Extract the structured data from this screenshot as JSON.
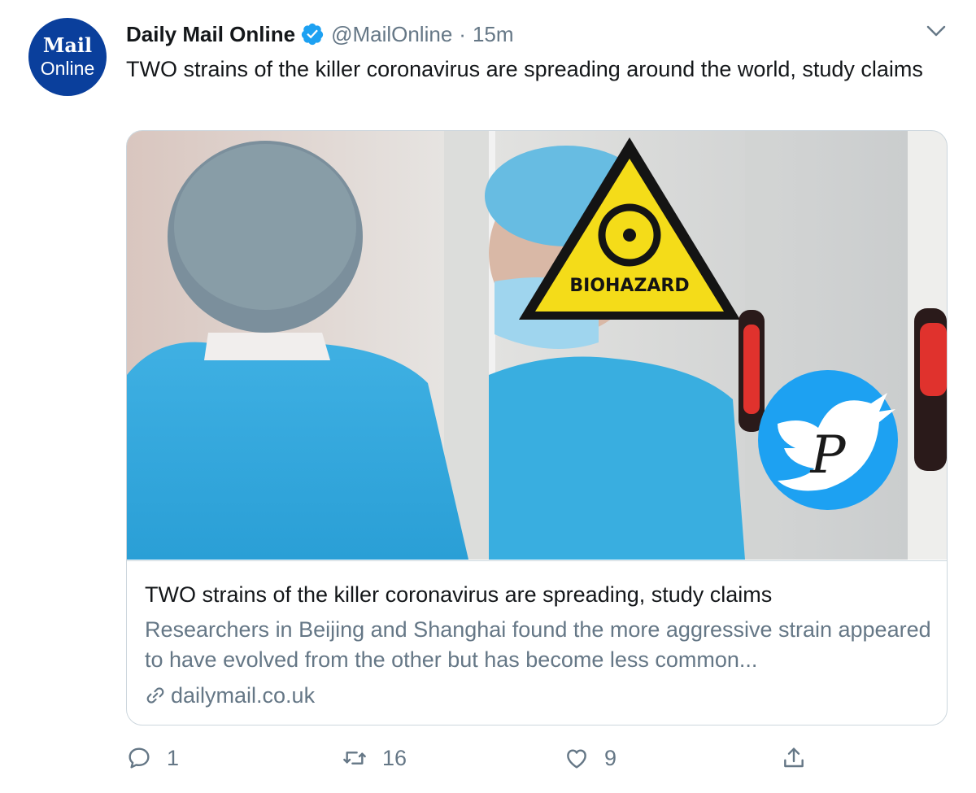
{
  "avatar": {
    "line1": "Mail",
    "line2": "Online",
    "bg_color": "#0a3f9c"
  },
  "header": {
    "name": "Daily Mail Online",
    "verified_icon": "verified-badge-icon",
    "handle": "@MailOnline",
    "separator": "·",
    "time": "15m",
    "menu_icon": "chevron-down-icon"
  },
  "tweet": {
    "text": "TWO strains of the killer coronavirus are spreading around the world, study claims"
  },
  "card": {
    "image_sign_text": "BIOHAZARD",
    "title": "TWO strains of the killer coronavirus are spreading, study claims",
    "description": "Researchers in Beijing and Shanghai found the more aggressive strain appeared to have evolved from the other but has become less common...",
    "domain": "dailymail.co.uk",
    "link_icon": "link-icon"
  },
  "actions": {
    "reply_count": "1",
    "retweet_count": "16",
    "like_count": "9",
    "share_icon": "share-icon"
  },
  "colors": {
    "text": "#14171a",
    "secondary": "#657786",
    "verified": "#1da1f2",
    "border": "#ccd6dd",
    "twitter_blue": "#1da1f2"
  }
}
